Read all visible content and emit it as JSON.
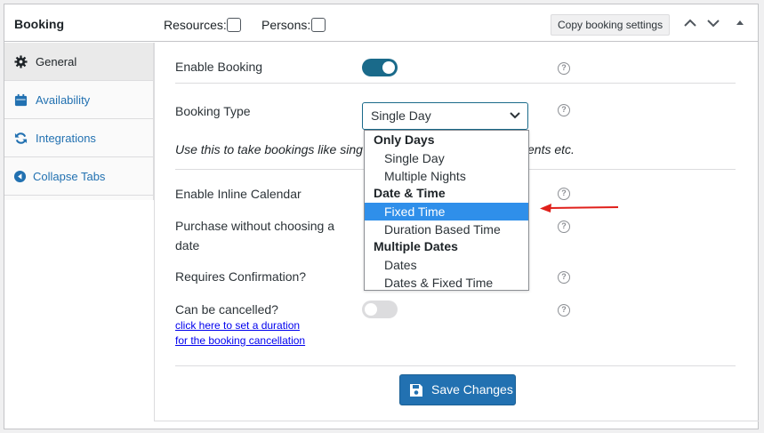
{
  "header": {
    "title": "Booking",
    "resources_label": "Resources:",
    "persons_label": "Persons:",
    "copy_button": "Copy booking settings"
  },
  "sidebar": {
    "items": [
      {
        "label": "General",
        "icon": "gear-icon"
      },
      {
        "label": "Availability",
        "icon": "calendar-icon"
      },
      {
        "label": "Integrations",
        "icon": "sync-icon"
      },
      {
        "label": "Collapse Tabs",
        "icon": "collapse-left-icon"
      }
    ]
  },
  "main": {
    "enable_booking": "Enable Booking",
    "booking_type": "Booking Type",
    "booking_type_value": "Single Day",
    "description_left": "Use this to take bookings like sing",
    "description_right": "ents etc.",
    "inline_calendar": "Enable Inline Calendar",
    "purchase_line1": "Purchase without choosing a",
    "purchase_line2": "date",
    "requires_confirmation": "Requires Confirmation?",
    "can_be_cancelled": "Can be cancelled?",
    "cancel_link_line1": "click here to set a duration",
    "cancel_link_line2": "for the booking cancellation",
    "save_button": "Save Changes"
  },
  "dropdown": {
    "groups": [
      {
        "label": "Only Days",
        "options": [
          "Single Day",
          "Multiple Nights"
        ]
      },
      {
        "label": "Date & Time",
        "options": [
          "Fixed Time",
          "Duration Based Time"
        ]
      },
      {
        "label": "Multiple Dates",
        "options": [
          "Dates",
          "Dates & Fixed Time"
        ]
      }
    ],
    "highlighted": "Fixed Time"
  },
  "colors": {
    "accent": "#2271b1",
    "toggle_on": "#1a6a8a",
    "highlight": "#2f8fea",
    "arrow": "#e0201b"
  }
}
